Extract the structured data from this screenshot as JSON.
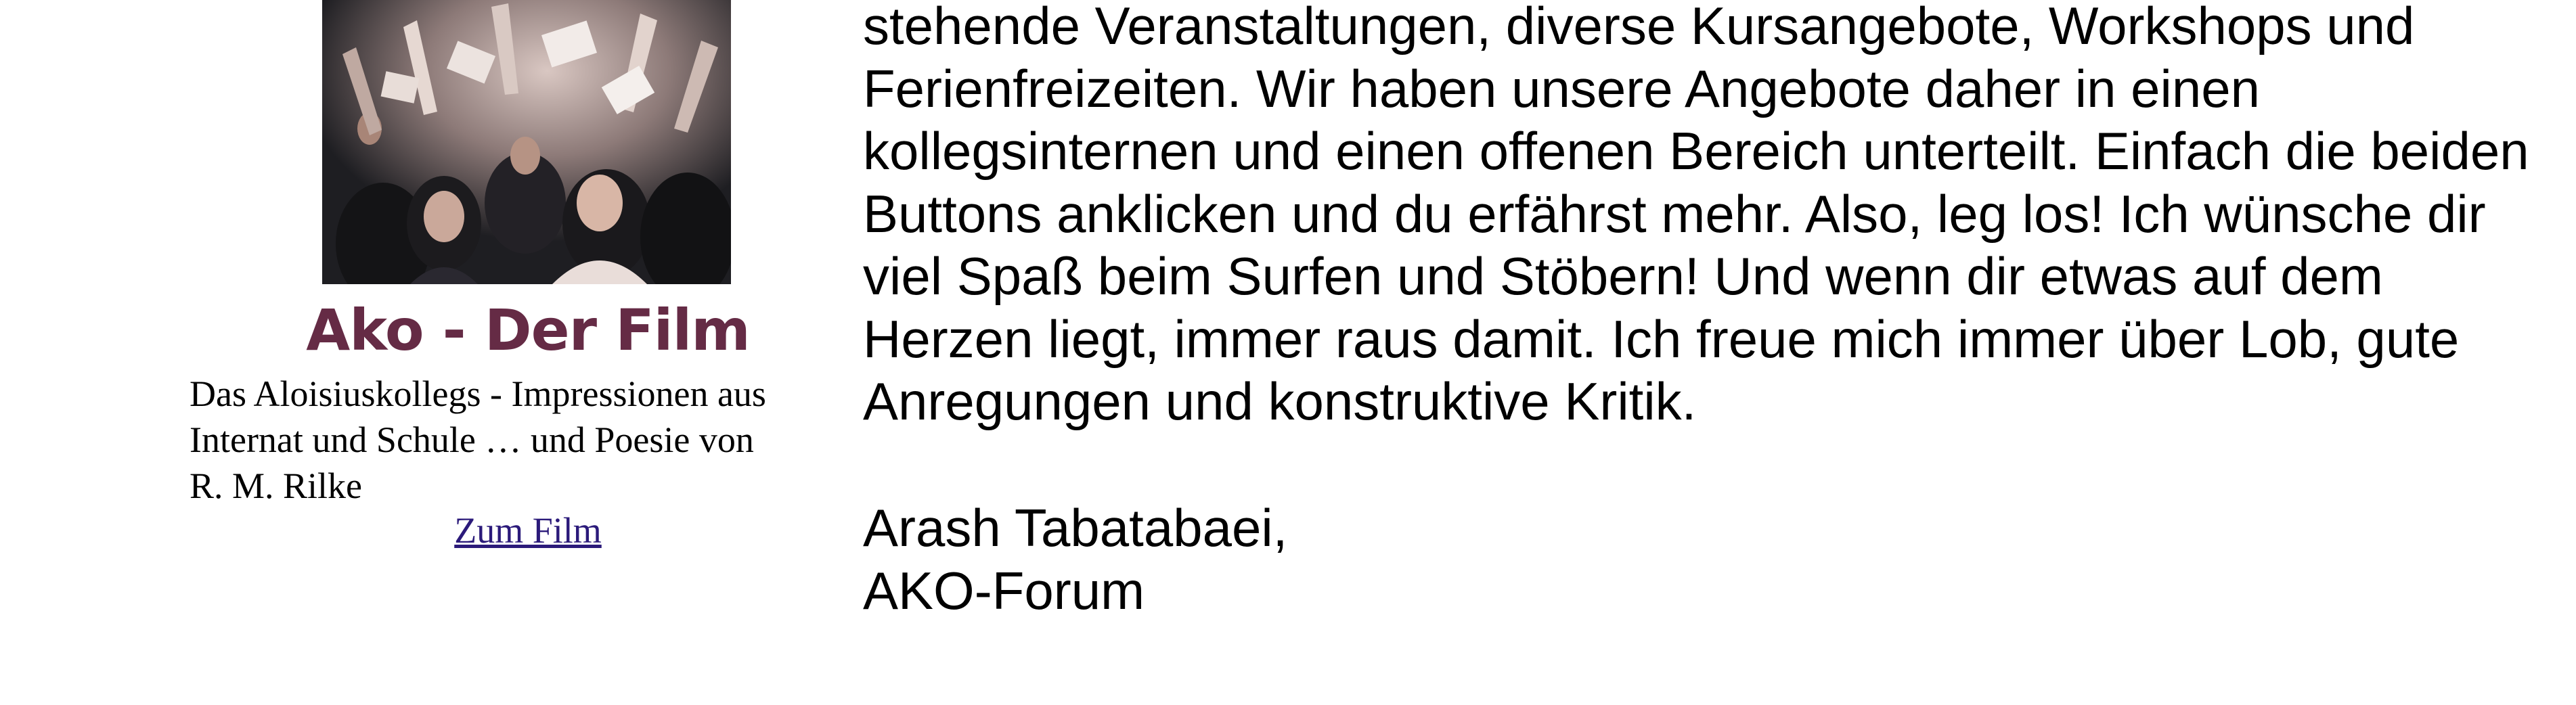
{
  "film_teaser": {
    "title": "Ako - Der Film",
    "description_lines": [
      "Das Aloisiuskollegs - Impressionen aus",
      "Internat und Schule … und Poesie von",
      "R. M. Rilke"
    ],
    "link_label": "Zum Film",
    "title_color": "#652b45",
    "link_color": "#2b1a7a"
  },
  "intro": {
    "lines": [
      "stehende Veranstaltungen, diverse Kursangebote, Workshops und",
      "Ferienfreizeiten. Wir haben unsere Angebote daher in einen",
      "kollegsinternen und einen offenen Bereich unterteilt. Einfach die beiden",
      "Buttons anklicken und du erfährst mehr. Also, leg los! Ich wünsche dir",
      "viel Spaß beim Surfen und Stöbern! Und wenn dir etwas auf dem",
      "Herzen liegt, immer raus damit. Ich freue mich immer über Lob, gute",
      "Anregungen und konstruktive Kritik."
    ],
    "signature_name": "Arash Tabatabaei,",
    "signature_org": "AKO-Forum"
  }
}
